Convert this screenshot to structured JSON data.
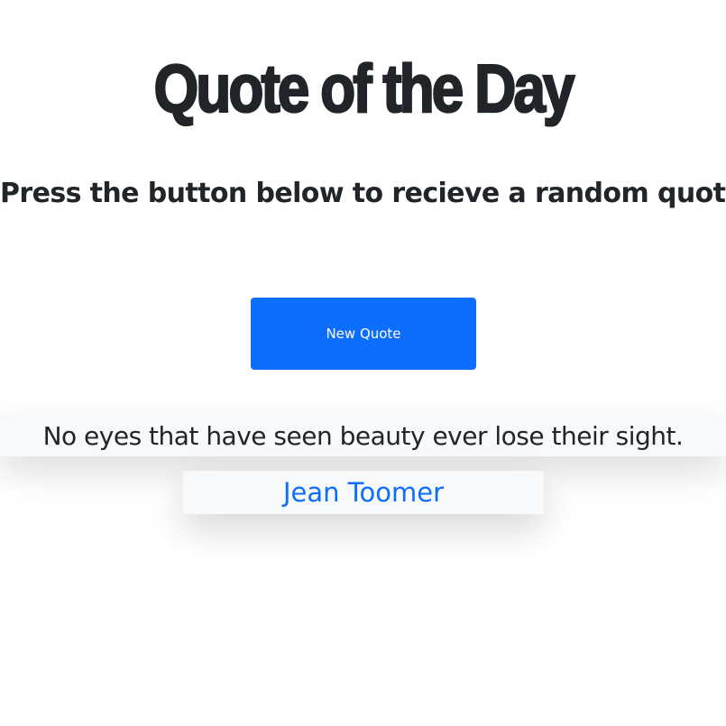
{
  "header": {
    "title": "Quote of the Day",
    "subtitle": "Press the button below to recieve a random quote!"
  },
  "controls": {
    "new_quote_label": "New Quote"
  },
  "quote": {
    "text": "No eyes that have seen beauty ever lose their sight.",
    "author": "Jean Toomer"
  },
  "colors": {
    "accent": "#0d6efd",
    "text": "#212529",
    "panel": "#f8f9fa",
    "background": "#ffffff"
  }
}
